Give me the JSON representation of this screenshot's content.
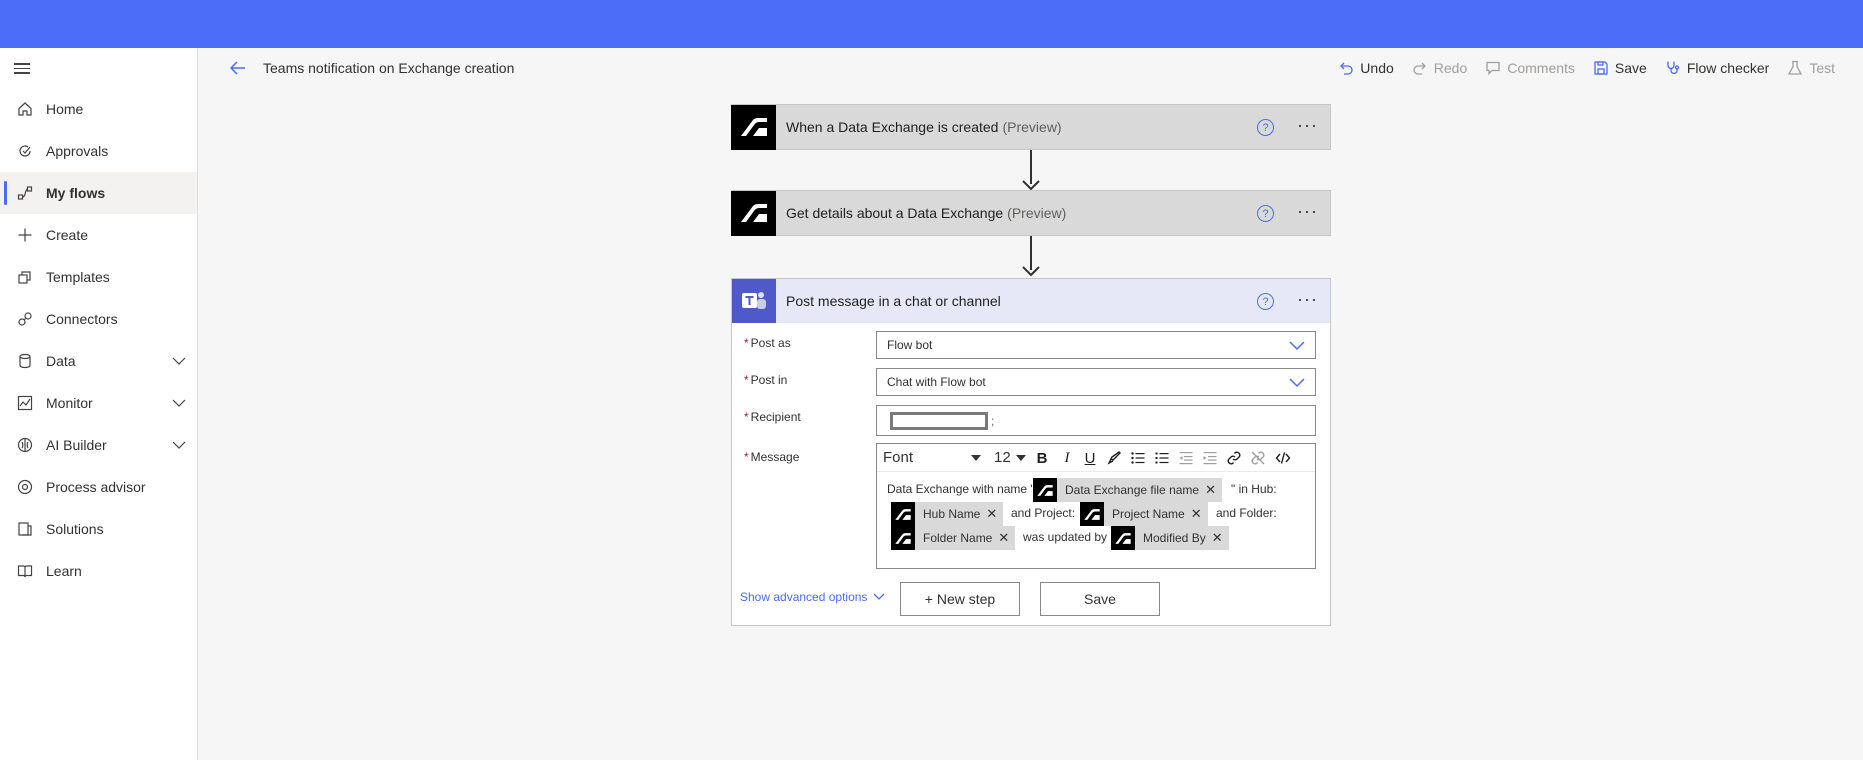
{
  "header": {
    "flow_title": "Teams notification on Exchange creation",
    "toolbar": {
      "undo": "Undo",
      "redo": "Redo",
      "comments": "Comments",
      "save": "Save",
      "flow_checker": "Flow checker",
      "test": "Test"
    }
  },
  "sidebar": {
    "items": [
      {
        "label": "Home",
        "icon": "home-icon"
      },
      {
        "label": "Approvals",
        "icon": "approvals-icon"
      },
      {
        "label": "My flows",
        "icon": "flows-icon",
        "active": true
      },
      {
        "label": "Create",
        "icon": "plus-icon"
      },
      {
        "label": "Templates",
        "icon": "templates-icon"
      },
      {
        "label": "Connectors",
        "icon": "connectors-icon"
      },
      {
        "label": "Data",
        "icon": "data-icon",
        "expandable": true
      },
      {
        "label": "Monitor",
        "icon": "monitor-icon",
        "expandable": true
      },
      {
        "label": "AI Builder",
        "icon": "ai-builder-icon",
        "expandable": true
      },
      {
        "label": "Process advisor",
        "icon": "process-advisor-icon"
      },
      {
        "label": "Solutions",
        "icon": "solutions-icon"
      },
      {
        "label": "Learn",
        "icon": "learn-icon"
      }
    ]
  },
  "steps": {
    "trigger": {
      "title": "When a Data Exchange is created",
      "suffix": "(Preview)"
    },
    "get_details": {
      "title": "Get details about a Data Exchange",
      "suffix": "(Preview)"
    },
    "post_message": {
      "title": "Post message in a chat or channel",
      "fields": {
        "post_as": {
          "label": "Post as",
          "value": "Flow bot"
        },
        "post_in": {
          "label": "Post in",
          "value": "Chat with Flow bot"
        },
        "recipient": {
          "label": "Recipient",
          "suffix": ";"
        },
        "message": {
          "label": "Message"
        }
      },
      "editor": {
        "font": "Font",
        "size": "12",
        "bold": "B",
        "italic": "I",
        "underline": "U",
        "text": {
          "t1": "Data Exchange with name \"",
          "t2": "\" in Hub:",
          "t3": "and Project:",
          "t4": "and Folder:",
          "t5": "was updated by"
        },
        "tokens": {
          "file_name": "Data Exchange file name",
          "hub_name": "Hub Name",
          "project_name": "Project Name",
          "folder_name": "Folder Name",
          "modified_by": "Modified By"
        }
      },
      "show_advanced": "Show advanced options"
    }
  },
  "buttons": {
    "new_step": "+ New step",
    "save": "Save"
  },
  "colors": {
    "top_bar": "#4a6cf7",
    "accent": "#4a6cf7",
    "teams": "#5059c9",
    "card_header": "#d9d9d9",
    "teams_header": "#e6e8f7"
  }
}
